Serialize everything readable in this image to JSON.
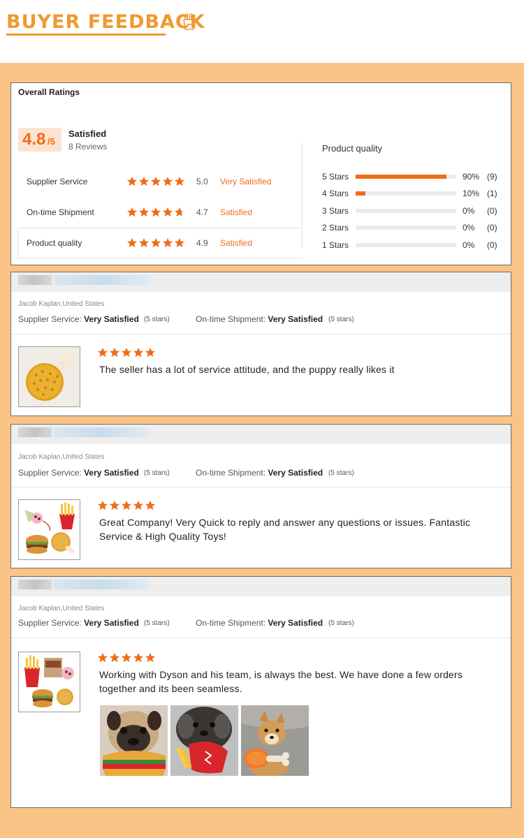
{
  "header": {
    "title": "BUYER FEEDBACK",
    "icon": "fries-icon",
    "accent_color": "#ef9a2f"
  },
  "theme": {
    "band_color": "#f9c486",
    "star_color": "#ef6d14"
  },
  "overall": {
    "title": "Overall Ratings",
    "score": "4.8",
    "score_max": "/5",
    "label": "Satisfied",
    "reviews": "8 Reviews",
    "rows": [
      {
        "label": "Supplier Service",
        "stars": 5,
        "value": "5.0",
        "word": "Very Satisfied"
      },
      {
        "label": "On-time Shipment",
        "stars": 4.7,
        "value": "4.7",
        "word": "Satisfied"
      },
      {
        "label": "Product quality",
        "stars": 5,
        "value": "4.9",
        "word": "Satisfied"
      }
    ],
    "product_quality": {
      "title": "Product quality",
      "rows": [
        {
          "label": "5 Stars",
          "percent": "90%",
          "count": "(9)",
          "fill": 0.9
        },
        {
          "label": "4 Stars",
          "percent": "10%",
          "count": "(1)",
          "fill": 0.1
        },
        {
          "label": "3 Stars",
          "percent": "0%",
          "count": "(0)",
          "fill": 0
        },
        {
          "label": "2 Stars",
          "percent": "0%",
          "count": "(0)",
          "fill": 0
        },
        {
          "label": "1 Stars",
          "percent": "0%",
          "count": "(0)",
          "fill": 0
        }
      ]
    }
  },
  "reviews": [
    {
      "reviewer": "Jacob Kaplan,United States",
      "supplier_label": "Supplier Service:",
      "supplier_value": "Very Satisfied",
      "supplier_stars": "(5 stars)",
      "shipment_label": "On-time Shipment:",
      "shipment_value": "Very Satisfied",
      "shipment_stars": "(5 stars)",
      "rating": 5,
      "text": "The seller has a lot of service attitude, and the puppy really likes it",
      "thumbnail": "fried-chicken-toy-photo"
    },
    {
      "reviewer": "Jacob Kaplan,United States",
      "supplier_label": "Supplier Service:",
      "supplier_value": "Very Satisfied",
      "supplier_stars": "(5 stars)",
      "shipment_label": "On-time Shipment:",
      "shipment_value": "Very Satisfied",
      "shipment_stars": "(5 stars)",
      "rating": 5,
      "text": "Great Company! Very Quick to reply and answer any questions or issues. Fantastic Service & High Quality Toys!",
      "thumbnail": "food-toys-set-photo"
    },
    {
      "reviewer": "Jacob Kaplan,United States",
      "supplier_label": "Supplier Service:",
      "supplier_value": "Very Satisfied",
      "supplier_stars": "(5 stars)",
      "shipment_label": "On-time Shipment:",
      "shipment_value": "Very Satisfied",
      "shipment_stars": "(5 stars)",
      "rating": 5,
      "text": "Working with Dyson and his team, is always the best.  We have done a few orders together and its been seamless.",
      "thumbnail": "food-toys-with-box-photo",
      "photos": [
        "pug-with-burger-toy-photo",
        "dog-with-fries-toy-photo",
        "shiba-with-drumstick-toy-photo"
      ]
    }
  ]
}
